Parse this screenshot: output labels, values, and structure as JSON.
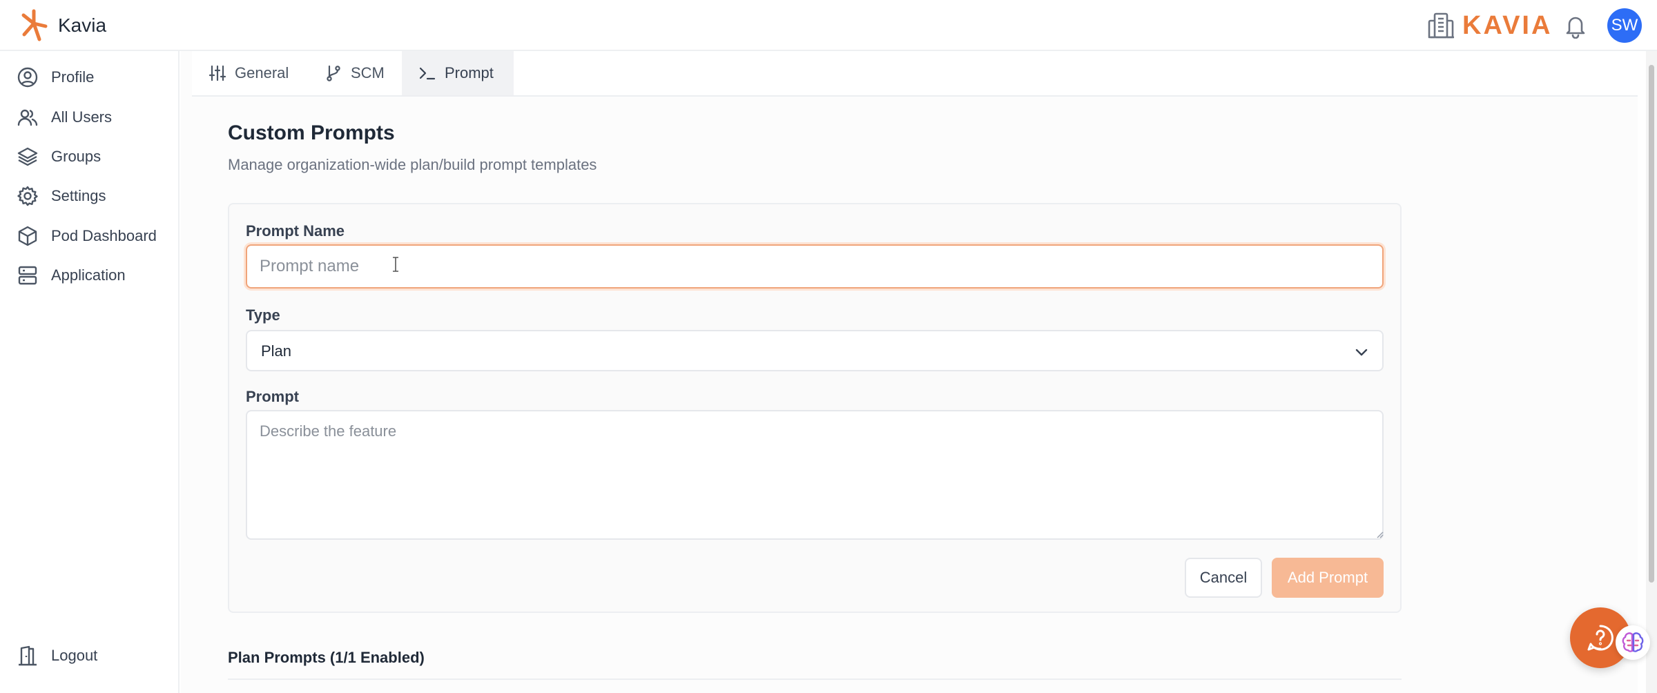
{
  "app": {
    "name": "Kavia",
    "brand_wordmark": "KAVIA",
    "avatar_initials": "SW"
  },
  "colors": {
    "accent": "#ea7b3a",
    "avatar_bg": "#2d6df6",
    "add_button_disabled": "#f7b995",
    "focus_border": "#f0a47a"
  },
  "sidebar": {
    "items": [
      {
        "label": "Profile",
        "icon": "user-circle-icon"
      },
      {
        "label": "All Users",
        "icon": "users-icon"
      },
      {
        "label": "Groups",
        "icon": "layers-icon"
      },
      {
        "label": "Settings",
        "icon": "gear-icon"
      },
      {
        "label": "Pod Dashboard",
        "icon": "cube-icon"
      },
      {
        "label": "Application",
        "icon": "server-icon"
      }
    ],
    "logout": {
      "label": "Logout",
      "icon": "door-exit-icon"
    }
  },
  "tabs": [
    {
      "label": "General",
      "icon": "sliders-icon"
    },
    {
      "label": "SCM",
      "icon": "git-branch-icon"
    },
    {
      "label": "Prompt",
      "icon": "terminal-icon",
      "active": true
    }
  ],
  "page": {
    "title": "Custom Prompts",
    "subtitle": "Manage organization-wide plan/build prompt templates"
  },
  "form": {
    "name_label": "Prompt Name",
    "name_placeholder": "Prompt name",
    "name_value": "",
    "type_label": "Type",
    "type_value": "Plan",
    "prompt_label": "Prompt",
    "prompt_placeholder": "Describe the feature",
    "prompt_value": "",
    "cancel_label": "Cancel",
    "add_label": "Add Prompt"
  },
  "plan_section": {
    "title": "Plan Prompts (1/1 Enabled)"
  }
}
